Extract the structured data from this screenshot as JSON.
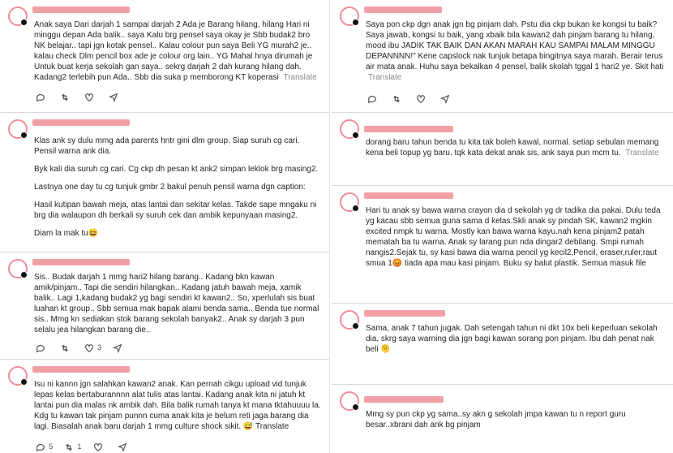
{
  "translate_label": "Translate",
  "left": [
    {
      "paragraphs": [
        "Anak saya Dari darjah 1 sampai darjah 2 Ada je Barang hilang, hilang Hari ni minggu depan Ada balik.. saya Kalu brg pensel saya okay je Sbb budak2 bro NK belajar.. tapi jgn kotak pensel.. Kalau colour pun saya Beli YG murah2 je.. kalau check Dlm pencil box ade je colour org lain.. YG Mahal hnya dirumah je Untuk buat kerja sekolah gan saya.. sekrg darjah 2 dah kurang hilang dah. Kadang2 terlebih pun Ada.. Sbb dia suka p memborong KT koperasi"
      ],
      "translate": true,
      "actions": {
        "reply": "",
        "retweet": "",
        "like": ""
      }
    },
    {
      "paragraphs": [
        "Klas ank sy dulu mmg ada parents hntr gini dlm group. Siap suruh cg cari. Pensil warna ank dia.",
        "Byk kali dia suruh cg cari. Cg ckp dh pesan kt ank2 simpan leklok brg masing2.",
        "Lastnya one day tu cg tunjuk gmbr 2 bakul penuh pensil warna dgn caption:",
        "Hasil kutipan bawah meja, atas lantai dan sekitar kelas. Takde sape mngaku ni brg dia walaupon dh berkali sy suruh cek dan ambik kepunyaan masing2.",
        "Diam la mak tu😆"
      ],
      "translate": false,
      "actions": {
        "reply": "",
        "retweet": "",
        "like": ""
      }
    },
    {
      "paragraphs": [
        "Sis.. Budak darjah 1 mmg hari2 hilang barang.. Kadang bkn kawan amik/pinjam.. Tapi die sendiri hilangkan.. Kadang jatuh bawah meja, xamik balik.. Lagi 1,kadang budak2 yg bagi sendiri kt kawan2.. So, xperlulah sis buat luahan kt group.. Sbb semua mak bapak alami benda sama.. Benda tue normal sis.. Mmg kn sediakan stok barang sekolah banyak2.. Anak sy darjah 3 pun selalu jea hilangkan barang die.."
      ],
      "translate": false,
      "actions": {
        "reply": "",
        "retweet": "",
        "like": "3"
      }
    },
    {
      "paragraphs": [
        "Isu ni kannn jgn salahkan kawan2 anak. Kan pernah cikgu upload vid tunjuk lepas kelas bertaburannnn alat tulis atas lantai. Kadang anak kita ni jatuh kt lantai pun dia malas nk ambik dah. Bila balik rumah tanya kt mana tktahuuuu la. Kdg tu kawan tak pinjam punnn cuma anak kita je belum reti jaga barang dia lagi. Biasalah anak baru darjah 1 mmg culture shock sikit. 😅 Translate"
      ],
      "translate": false,
      "actions": {
        "reply": "5",
        "retweet": "1",
        "like": ""
      }
    }
  ],
  "right": [
    {
      "paragraphs": [
        "Saya pon ckp dgn anak jgn bg pinjam dah. Pstu dia ckp bukan ke kongsi tu baik? Saya jawab, kongsi tu baik, yang xbaik bila kawan2 dah pinjam barang tu hilang, mood ibu JADIK TAK BAIK DAN AKAN MARAH KAU SAMPAI MALAM MINGGU DEPANNNN!\" Kene capslock nak tunjuk betapa bingitnya saya marah. Berair terus air mata anak. Huhu saya bekalkan 4 pensel, balik skolah tggal 1 hari2 ye. Skit hati"
      ],
      "translate": true,
      "actions": {
        "reply": "",
        "retweet": "",
        "like": ""
      }
    },
    {
      "paragraphs": [
        "dorang baru tahun benda tu kita tak boleh kawal, normal. setiap sebulan memang kena beli topup yg baru. tqk kata dekat anak sis, ank saya pun mcm tu."
      ],
      "translate": true,
      "actions": {}
    },
    {
      "paragraphs": [
        "Hari tu anak sy bawa warna crayon dia d sekolah yg dr tadika dia pakai. Dulu teda yg kacau sbb semua guna sama d kelas.Skli anak sy pindah SK, kawan2 mgkin excited nmpk tu warna. Mostly kan bawa warna kayu.nah kena pinjam2 patah mematah ba tu warna. Anak sy larang pun nda dingar2 debilang. Smpi rumah nangis2.Sejak tu, sy kasi bawa dia warna pencil yg kecil2,Pencil, eraser,ruler,raut smua 1😡 tiada apa mau kasi pinjam. Buku sy balut plastik. Semua masuk file"
      ],
      "translate": false,
      "actions": {}
    },
    {
      "paragraphs": [
        "Sama, anak 7 tahun jugak. Dah setengah tahun ni dkt 10x beli keperluan sekolah dia, skrg saya warning dia jgn bagi kawan sorang pon pinjam. Ibu dah penat nak beli 🫠"
      ],
      "translate": false,
      "actions": {}
    },
    {
      "paragraphs": [
        "Mmg sy pun ckp yg sama..sy akn g sekolah jmpa kawan tu n report guru besar..xbrani dah ank bg pinjam"
      ],
      "translate": false,
      "actions": {}
    }
  ]
}
